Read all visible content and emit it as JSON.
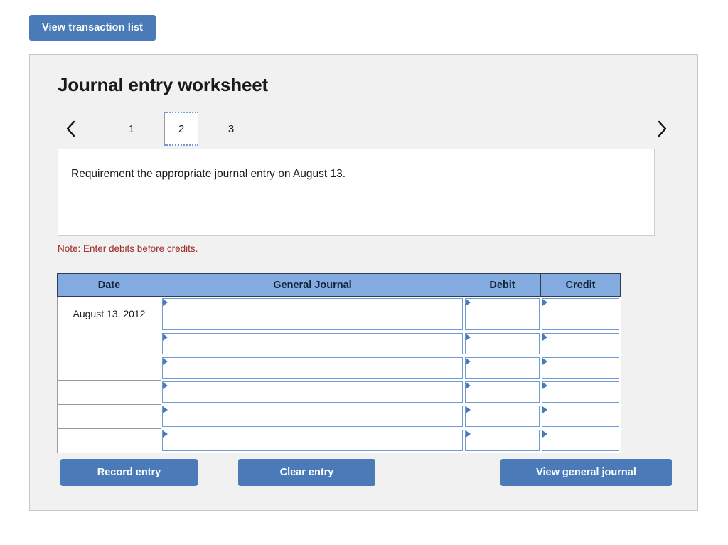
{
  "toolbar": {
    "view_transaction_label": "View transaction list"
  },
  "panel": {
    "title": "Journal entry worksheet",
    "pager": {
      "prev_icon": "chevron-left-icon",
      "next_icon": "chevron-right-icon",
      "tabs": [
        {
          "label": "1",
          "selected": false
        },
        {
          "label": "2",
          "selected": true
        },
        {
          "label": "3",
          "selected": false
        }
      ]
    },
    "requirement": {
      "text": "Requirement the appropriate journal entry on August 13."
    },
    "note": "Note: Enter debits before credits.",
    "table": {
      "columns": [
        "Date",
        "General Journal",
        "Debit",
        "Credit"
      ],
      "rows": [
        {
          "date": "August 13, 2012",
          "general_journal": "",
          "debit": "",
          "credit": ""
        },
        {
          "date": "",
          "general_journal": "",
          "debit": "",
          "credit": ""
        },
        {
          "date": "",
          "general_journal": "",
          "debit": "",
          "credit": ""
        },
        {
          "date": "",
          "general_journal": "",
          "debit": "",
          "credit": ""
        },
        {
          "date": "",
          "general_journal": "",
          "debit": "",
          "credit": ""
        },
        {
          "date": "",
          "general_journal": "",
          "debit": "",
          "credit": ""
        }
      ]
    },
    "actions": {
      "record_label": "Record entry",
      "clear_label": "Clear entry",
      "view_journal_label": "View general journal"
    }
  },
  "colors": {
    "button_blue": "#4a7ab8",
    "header_blue": "#83abe0",
    "note_red": "#9e2b25",
    "panel_bg": "#f1f1f1",
    "field_border": "#6f9ad4"
  }
}
